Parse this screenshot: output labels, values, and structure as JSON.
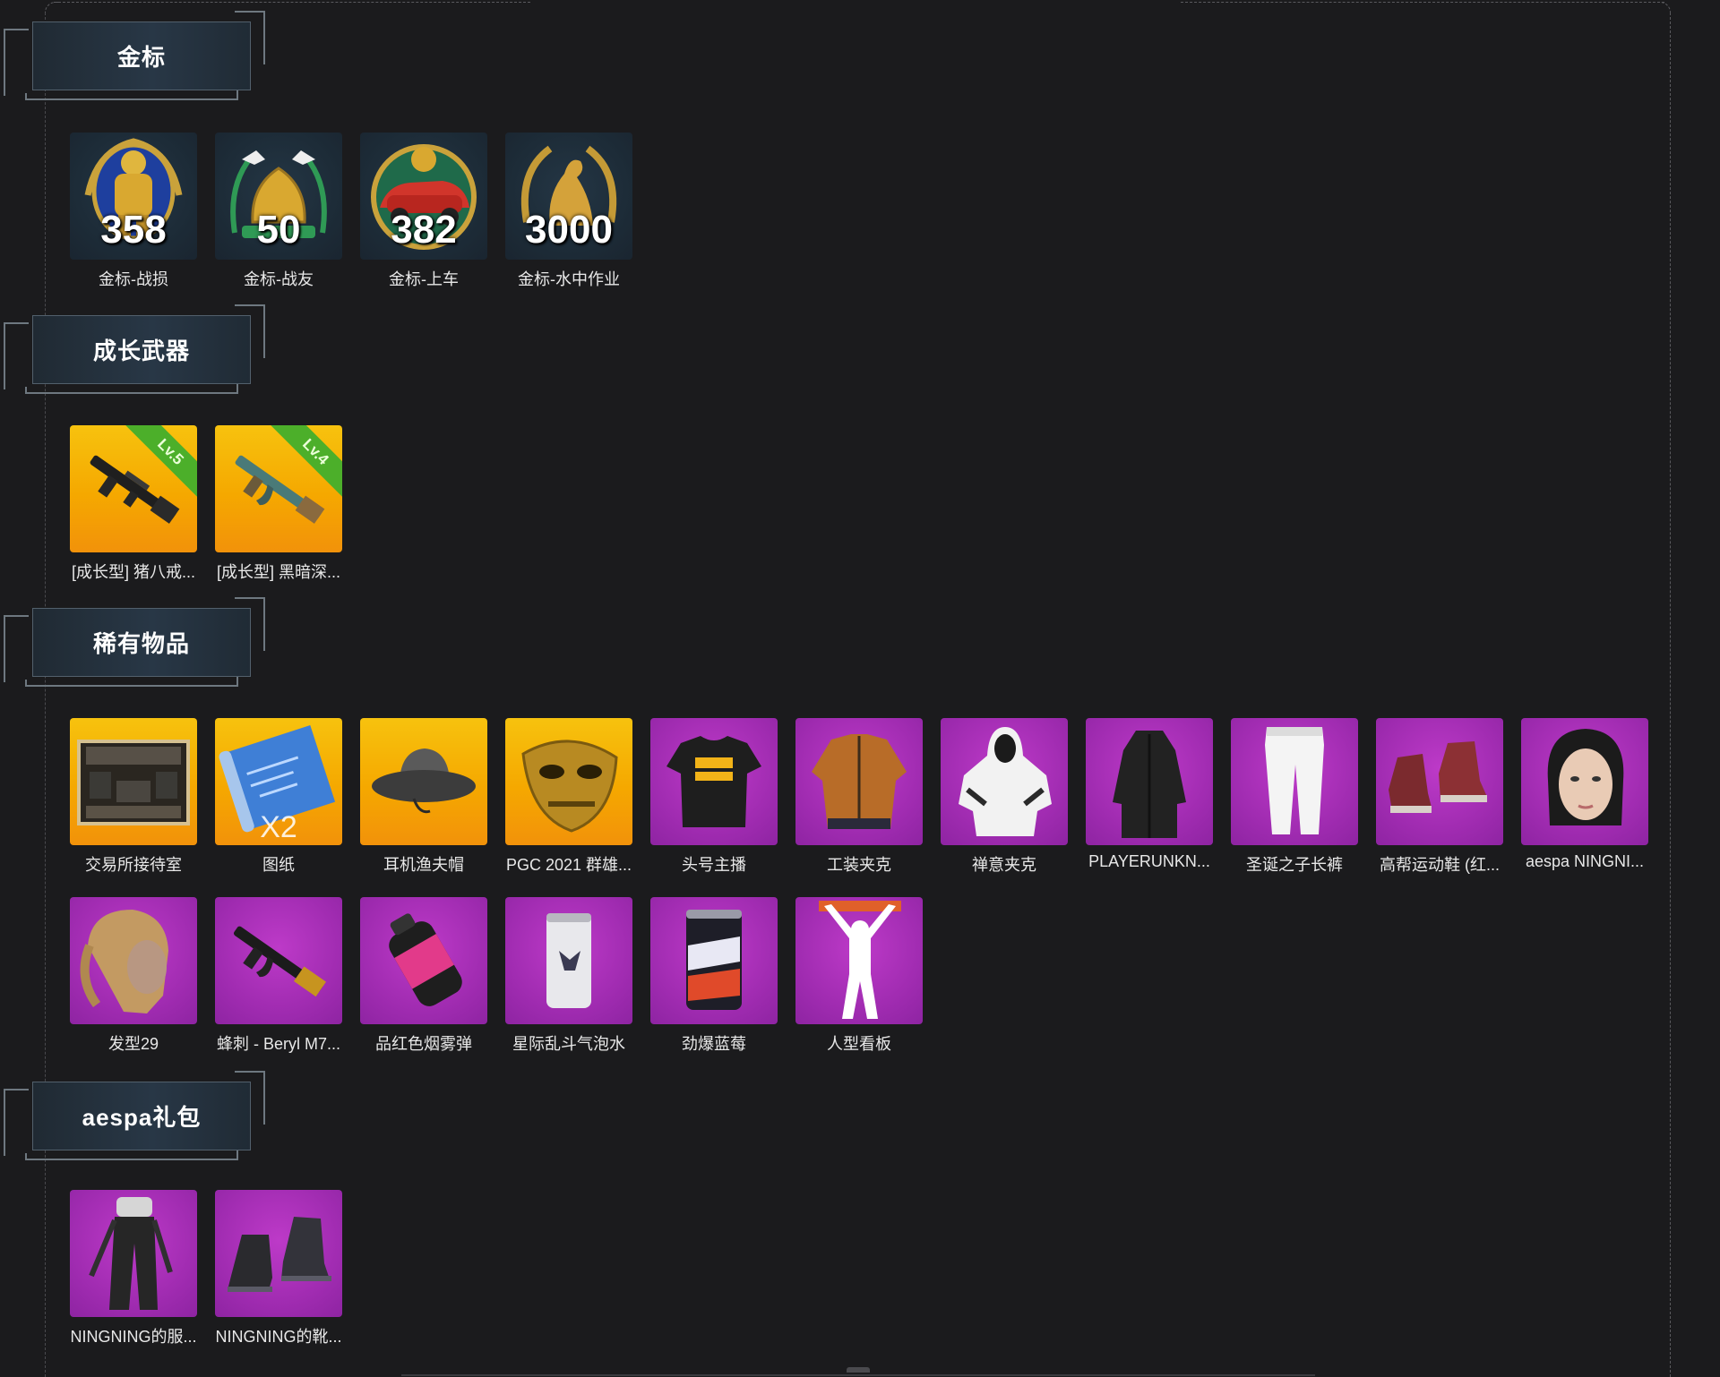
{
  "sections": [
    {
      "title": "金标",
      "items": [
        {
          "name": "金标-战损",
          "count": "358",
          "icon": "gold-soldier-medal-icon"
        },
        {
          "name": "金标-战友",
          "count": "50",
          "icon": "gold-doves-medal-icon"
        },
        {
          "name": "金标-上车",
          "count": "382",
          "icon": "gold-car-medal-icon"
        },
        {
          "name": "金标-水中作业",
          "count": "3000",
          "icon": "gold-seal-medal-icon"
        }
      ]
    },
    {
      "title": "成长武器",
      "items": [
        {
          "name": "[成长型] 猪八戒...",
          "level": "Lv.5",
          "icon": "rifle-icon"
        },
        {
          "name": "[成长型] 黑暗深...",
          "level": "Lv.4",
          "icon": "rifle-icon"
        }
      ]
    },
    {
      "title": "稀有物品",
      "items": [
        {
          "name": "交易所接待室",
          "icon": "room-icon"
        },
        {
          "name": "图纸",
          "badge": "X2",
          "icon": "blueprint-icon"
        },
        {
          "name": "耳机渔夫帽",
          "icon": "bucket-hat-icon"
        },
        {
          "name": "PGC 2021 群雄...",
          "icon": "gold-mask-icon"
        },
        {
          "name": "头号主播",
          "icon": "tshirt-icon"
        },
        {
          "name": "工装夹克",
          "icon": "jacket-icon"
        },
        {
          "name": "禅意夹克",
          "icon": "hoodie-icon"
        },
        {
          "name": "PLAYERUNKN...",
          "icon": "coat-icon"
        },
        {
          "name": "圣诞之子长裤",
          "icon": "pants-icon"
        },
        {
          "name": "高帮运动鞋 (红...",
          "icon": "sneakers-icon"
        },
        {
          "name": "aespa NINGNI...",
          "icon": "face-icon"
        },
        {
          "name": "发型29",
          "icon": "hair-icon"
        },
        {
          "name": "蜂刺 - Beryl M7...",
          "icon": "rifle-icon"
        },
        {
          "name": "品红色烟雾弹",
          "icon": "smoke-grenade-icon"
        },
        {
          "name": "星际乱斗气泡水",
          "icon": "can-icon"
        },
        {
          "name": "劲爆蓝莓",
          "icon": "can-icon"
        },
        {
          "name": "人型看板",
          "icon": "human-sign-icon"
        }
      ]
    },
    {
      "title": "aespa礼包",
      "items": [
        {
          "name": "NINGNING的服...",
          "icon": "outfit-icon"
        },
        {
          "name": "NINGNING的靴...",
          "icon": "boots-icon"
        }
      ]
    }
  ],
  "colors": {
    "background": "#1b1b1d",
    "gold_tile": "#f5a800",
    "purple_tile": "#9f2bb0",
    "medal_tile": "#1d2c38",
    "level_ribbon": "#4caf2a"
  }
}
